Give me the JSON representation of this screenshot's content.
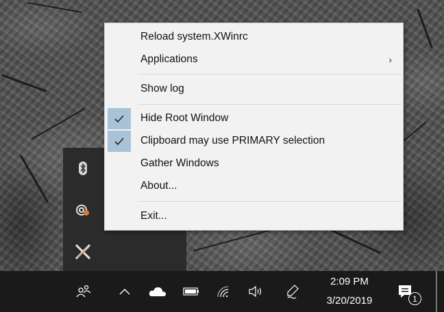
{
  "menu": {
    "items": [
      {
        "label": "Reload system.XWinrc",
        "checked": false,
        "submenu": false
      },
      {
        "label": "Applications",
        "checked": false,
        "submenu": true
      },
      {
        "label": "Show log",
        "checked": false,
        "submenu": false
      },
      {
        "label": "Hide Root Window",
        "checked": true,
        "submenu": false
      },
      {
        "label": "Clipboard may use PRIMARY selection",
        "checked": true,
        "submenu": false
      },
      {
        "label": "Gather Windows",
        "checked": false,
        "submenu": false
      },
      {
        "label": "About...",
        "checked": false,
        "submenu": false
      },
      {
        "label": "Exit...",
        "checked": false,
        "submenu": false
      }
    ],
    "check_highlight_color": "#a8c3d8",
    "submenu_arrow": "›"
  },
  "tray_overflow": {
    "icons": [
      "bluetooth-icon",
      "cloud-sync-icon",
      "x-server-icon"
    ]
  },
  "taskbar": {
    "icons": [
      "people-icon",
      "chevron-up-icon",
      "onedrive-icon",
      "battery-icon",
      "wifi-icon",
      "volume-icon",
      "pen-icon",
      "notification-icon"
    ],
    "time": "2:09 PM",
    "date": "3/20/2019",
    "notification_count": "1"
  }
}
